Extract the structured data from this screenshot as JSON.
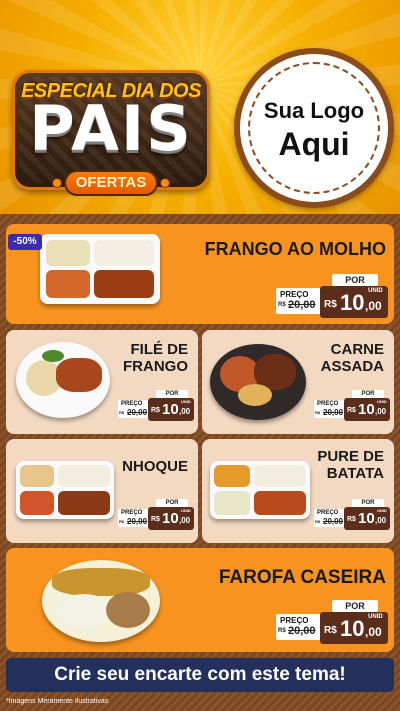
{
  "header": {
    "badge_top": "ESPECIAL DIA DOS",
    "badge_main": "PAIS",
    "badge_pill": "OFERTAS",
    "logo_line1": "Sua Logo",
    "logo_line2": "Aqui"
  },
  "discount_badge": "-50%",
  "price_labels": {
    "por": "POR",
    "preco": "PREÇO",
    "currency": "R$",
    "unit": "UNID"
  },
  "products": [
    {
      "name": "FRANGO AO MOLHO",
      "old_price": "20,00",
      "old_currency": "R$",
      "price_int": "10",
      "price_dec": ",00"
    },
    {
      "name_line1": "FILÉ DE",
      "name_line2": "FRANGO",
      "old_price": "20,00",
      "old_currency": "R$",
      "price_int": "10",
      "price_dec": ",00"
    },
    {
      "name_line1": "CARNE",
      "name_line2": "ASSADA",
      "old_price": "20,00",
      "old_currency": "R$",
      "price_int": "10",
      "price_dec": ",00"
    },
    {
      "name": "NHOQUE",
      "old_price": "20,00",
      "old_currency": "R$",
      "price_int": "10",
      "price_dec": ",00"
    },
    {
      "name_line1": "PURE DE",
      "name_line2": "BATATA",
      "old_price": "20,00",
      "old_currency": "R$",
      "price_int": "10",
      "price_dec": ",00"
    },
    {
      "name": "FAROFA CASEIRA",
      "old_price": "20,00",
      "old_currency": "R$",
      "price_int": "10",
      "price_dec": ",00"
    }
  ],
  "banner": "Crie seu encarte com este tema!",
  "footnote": "*Imagens Meramente Ilustrativas"
}
